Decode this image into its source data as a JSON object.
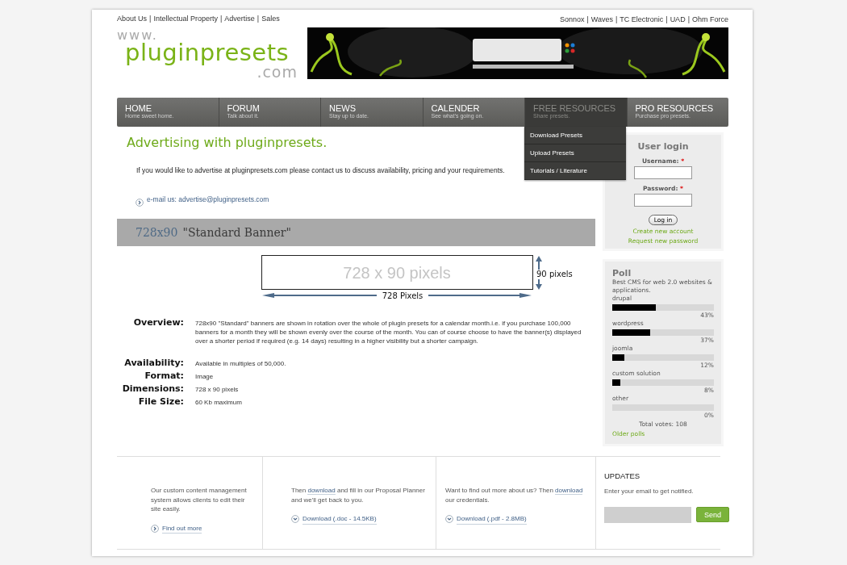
{
  "separator": "|",
  "top_links": [
    "About Us",
    "Intellectual Property",
    "Advertise",
    "Sales"
  ],
  "partner_links": [
    "Sonnox",
    "Waves",
    "TC Electronic",
    "UAD",
    "Ohm Force"
  ],
  "logo": {
    "prefix": "www.",
    "name": "pluginpresets",
    "suffix": ".com"
  },
  "banner": {
    "kind": "picture"
  },
  "nav": [
    {
      "label": "HOME",
      "subtitle": "Home sweet home.",
      "selected": false
    },
    {
      "label": "FORUM",
      "subtitle": "Talk about it.",
      "selected": false
    },
    {
      "label": "NEWS",
      "subtitle": "Stay up to date.",
      "selected": false
    },
    {
      "label": "CALENDER",
      "subtitle": "See what's going on.",
      "selected": false
    },
    {
      "label": "FREE RESOURCES",
      "subtitle": "Share presets.",
      "selected": true
    },
    {
      "label": "PRO RESOURCES",
      "subtitle": "Purchase pro presets.",
      "selected": false
    }
  ],
  "dropdown": [
    "Download Presets",
    "Upload Presets",
    "Tutorials / Literature"
  ],
  "page_title": "Advertising with pluginpresets.",
  "intro": "If you would like to advertise at pluginpresets.com please contact us to discuss availability, pricing and your requirements.",
  "email_link": "e-mail us: advertise@pluginpresets.com",
  "section_heading": {
    "size": "728x90",
    "name": "\"Standard Banner\""
  },
  "diagram": {
    "placeholder_text": "728 x 90 pixels",
    "height_label": "90 pixels",
    "width_label": "728 Pixels"
  },
  "details": [
    {
      "label": "Overview:",
      "value": "728x90 \"Standard\" banners are shown in rotation over the whole of plugin presets for a calendar month.i.e. if you purchase 100,000 banners for a month they will be shown evenly over the course of the month.  You can of course choose to have the banner(s) displayed over a shorter period if required (e.g. 14 days) resulting in a higher visibility but a shorter campaign."
    },
    {
      "label": "Availability:",
      "value": "Available in multiples of 50,000."
    },
    {
      "label": "Format:",
      "value": "Image"
    },
    {
      "label": "Dimensions:",
      "value": "728 x 90 pixels"
    },
    {
      "label": "File Size:",
      "value": "60 Kb maximum"
    }
  ],
  "login": {
    "title": "User login",
    "fields": [
      {
        "label": "Username:",
        "marker": "*"
      },
      {
        "label": "Password:",
        "marker": "*"
      }
    ],
    "button": "Log in",
    "links": [
      "Create new account",
      "Request new password"
    ]
  },
  "poll": {
    "title": "Poll",
    "question": "Best CMS for web 2.0 websites & applications.",
    "choices": [
      {
        "name": "drupal",
        "level": 0.43,
        "percent": "43%"
      },
      {
        "name": "wordpress",
        "level": 0.37,
        "percent": "37%"
      },
      {
        "name": "joomla",
        "level": 0.12,
        "percent": "12%"
      },
      {
        "name": "custom solution",
        "level": 0.08,
        "percent": "8%"
      },
      {
        "name": "other",
        "level": 0,
        "percent": "0%"
      }
    ],
    "total": "Total votes: 108",
    "older": "Older polls"
  },
  "footer": {
    "columns": [
      {
        "before": "Our custom content management system allows clients to edit their site easily.",
        "action": {
          "kind": "more",
          "label": "Find out more"
        }
      },
      {
        "before": "Then ",
        "link_text": "download",
        "after": " and fill in our Proposal Planner and we'll get back to you.",
        "action": {
          "kind": "download",
          "label": "Download (.doc - 14.5KB)"
        }
      },
      {
        "before": "Want to find out more about us? Then ",
        "link_text": "download",
        "after": " our credentials.",
        "action": {
          "kind": "download",
          "label": "Download (.pdf - 2.8MB)"
        }
      }
    ],
    "updates": {
      "title": "UPDATES",
      "text": "Enter your email to get notified.",
      "button": "Send"
    }
  }
}
